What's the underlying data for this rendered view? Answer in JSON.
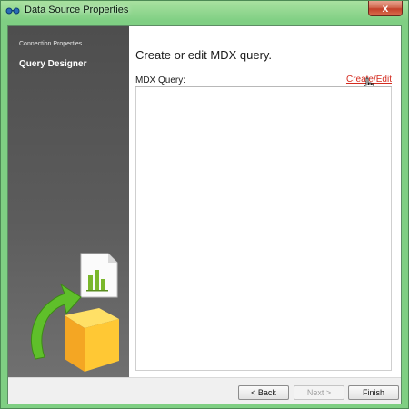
{
  "window": {
    "title": "Data Source Properties",
    "close_label": "x"
  },
  "sidebar": {
    "items": [
      {
        "label": "Connection Properties"
      },
      {
        "label": "Query Designer"
      }
    ]
  },
  "main": {
    "heading": "Create or edit MDX query.",
    "mdx_label": "MDX Query:",
    "create_edit_link": "Create/Edit",
    "query_text": ""
  },
  "footer": {
    "back_label": "< Back",
    "next_label": "Next >",
    "finish_label": "Finish"
  },
  "colors": {
    "frame": "#7fcf83",
    "sidebar": "#5c5c5c",
    "link": "#d42b1f"
  }
}
